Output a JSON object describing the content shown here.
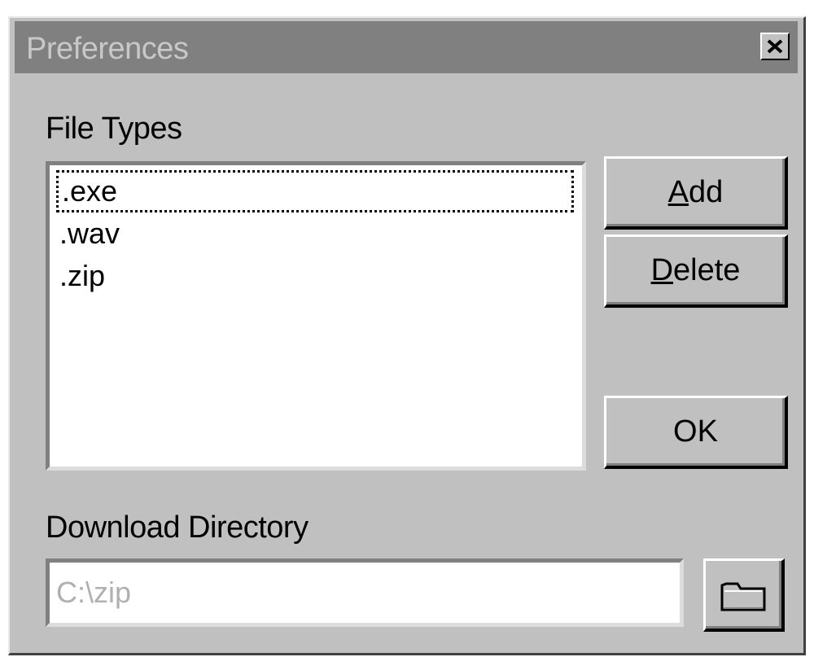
{
  "window": {
    "title": "Preferences",
    "close_icon": "close-icon"
  },
  "file_types": {
    "label": "File Types",
    "items": [
      ".exe",
      ".wav",
      ".zip"
    ],
    "focused_index": 0
  },
  "buttons": {
    "add": {
      "accel": "A",
      "rest": "dd"
    },
    "delete": {
      "accel": "D",
      "rest": "elete"
    },
    "ok": "OK"
  },
  "download": {
    "label": "Download Directory",
    "value": "C:\\zip",
    "browse_icon": "folder-icon"
  },
  "colors": {
    "face": "#c0c0c0",
    "titlebar": "#808080",
    "title_text": "#c8c8c8",
    "field": "#ffffff",
    "disabled_text": "#b0b0b0"
  }
}
